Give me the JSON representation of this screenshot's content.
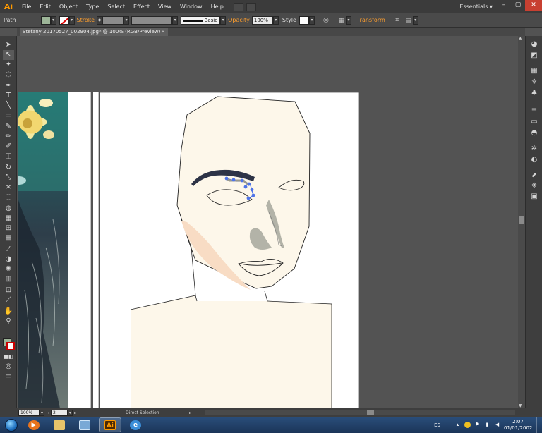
{
  "app": {
    "logo": "Ai",
    "menus": [
      "File",
      "Edit",
      "Object",
      "Type",
      "Select",
      "Effect",
      "View",
      "Window",
      "Help"
    ],
    "workspace": "Essentials",
    "window_controls": [
      "–",
      "▢",
      "✕"
    ]
  },
  "control_bar": {
    "selection_type": "Path",
    "stroke_label": "Stroke",
    "brush_label": "Basic",
    "opacity_label": "Opacity",
    "opacity_value": "100%",
    "style_label": "Style",
    "transform_label": "Transform",
    "fill_color": "#9db598"
  },
  "document": {
    "tab_title": "Stefany 20170527_002904.jpg* @ 100% (RGB/Preview)",
    "tab_close": "×"
  },
  "status_bar": {
    "zoom": "100%",
    "artboard": "2",
    "status_text": "Direct Selection"
  },
  "taskbar": {
    "language": "ES",
    "time": "2:07",
    "date": "01/01/2002",
    "apps": [
      "media-player",
      "file-explorer",
      "computer",
      "illustrator",
      "internet-explorer"
    ]
  },
  "colors": {
    "skin": "#fdf7ea",
    "cheek_blush": "#f8dcc4",
    "eyebrow": "#2d3346",
    "nose_shadow": "#b3b3a8",
    "selection_blue": "#4f74e8",
    "accent_orange": "#ff9a00"
  }
}
